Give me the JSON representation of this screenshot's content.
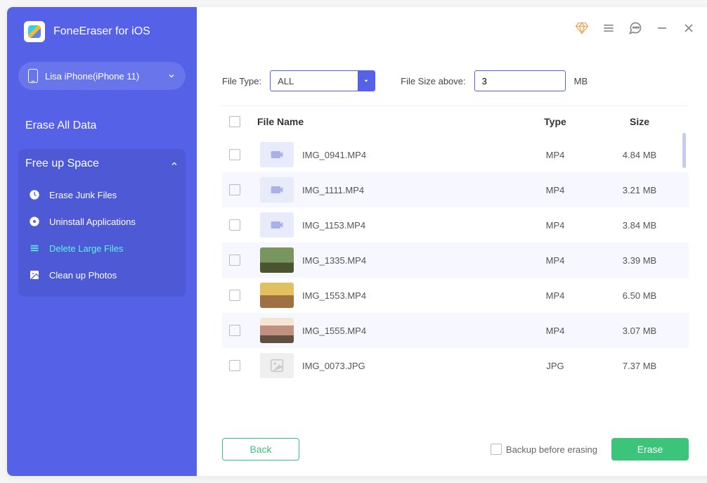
{
  "app": {
    "title": "FoneEraser for iOS"
  },
  "device": {
    "name": "Lisa iPhone(iPhone 11)"
  },
  "nav": {
    "erase_all": "Erase All Data",
    "free_up": "Free up Space",
    "junk": "Erase Junk Files",
    "uninstall": "Uninstall Applications",
    "large": "Delete Large Files",
    "photos": "Clean up Photos"
  },
  "filters": {
    "type_label": "File Type:",
    "type_value": "ALL",
    "size_label": "File Size above:",
    "size_value": "3",
    "size_unit": "MB"
  },
  "table": {
    "headers": {
      "name": "File Name",
      "type": "Type",
      "size": "Size"
    },
    "rows": [
      {
        "name": "IMG_0941.MP4",
        "type": "MP4",
        "size": "4.84 MB",
        "thumb": "video"
      },
      {
        "name": "IMG_1111.MP4",
        "type": "MP4",
        "size": "3.21 MB",
        "thumb": "video"
      },
      {
        "name": "IMG_1153.MP4",
        "type": "MP4",
        "size": "3.84 MB",
        "thumb": "video"
      },
      {
        "name": "IMG_1335.MP4",
        "type": "MP4",
        "size": "3.39 MB",
        "thumb": "photo"
      },
      {
        "name": "IMG_1553.MP4",
        "type": "MP4",
        "size": "6.50 MB",
        "thumb": "photo2"
      },
      {
        "name": "IMG_1555.MP4",
        "type": "MP4",
        "size": "3.07 MB",
        "thumb": "baby"
      },
      {
        "name": "IMG_0073.JPG",
        "type": "JPG",
        "size": "7.37 MB",
        "thumb": "jpg"
      }
    ]
  },
  "footer": {
    "back": "Back",
    "backup": "Backup before erasing",
    "erase": "Erase"
  }
}
